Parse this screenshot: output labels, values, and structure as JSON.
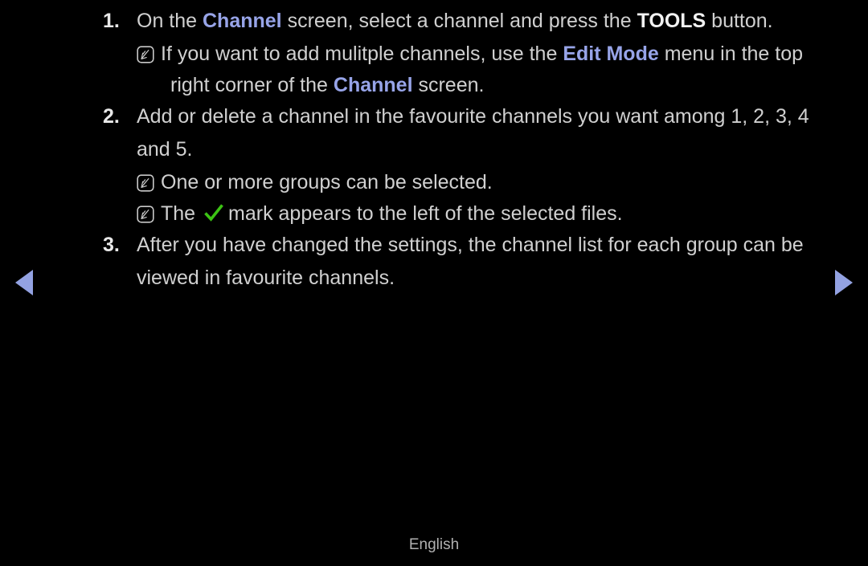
{
  "page": {
    "background_color": "#000000",
    "text_color": "#d0d0d0",
    "highlight_color": "#97a4e8",
    "check_color": "#3cc314",
    "arrow_color": "#93a2e2"
  },
  "steps": [
    {
      "number": "1.",
      "parts": [
        {
          "type": "text",
          "value": "On the "
        },
        {
          "type": "highlight",
          "value": "Channel"
        },
        {
          "type": "text",
          "value": " screen, select a channel and press the "
        },
        {
          "type": "strong",
          "value": "TOOLS"
        },
        {
          "type": "text",
          "value": " button."
        }
      ],
      "text": "On the Channel screen, select a channel and press the TOOLS button."
    },
    {
      "number": "2.",
      "parts": [
        {
          "type": "text",
          "value": "Add or delete a channel in the favourite channels you want among 1, 2, 3, 4 and 5."
        }
      ],
      "text": "Add or delete a channel in the favourite channels you want among 1, 2, 3, 4",
      "continuation": "and 5."
    },
    {
      "number": "3.",
      "parts": [
        {
          "type": "text",
          "value": "After you have changed the settings, the channel list for each group can be viewed in favourite channels."
        }
      ],
      "text": "After you have changed the settings, the channel list for each group can be",
      "continuation": "viewed in favourite channels."
    }
  ],
  "notes": [
    {
      "icon": "note-icon",
      "line1_before": "If you want to add mulitple channels, use the ",
      "highlight1": "Edit Mode",
      "line1_after": " menu in the top",
      "line2_before": "right corner of the ",
      "highlight2": "Channel",
      "line2_after": " screen.",
      "full_text": "If you want to add mulitple channels, use the Edit Mode menu in the top right corner of the Channel screen."
    },
    {
      "icon": "note-icon",
      "text": "One or more groups can be selected."
    },
    {
      "icon": "note-icon",
      "before_check": "The ",
      "after_check": "mark appears to the left of the selected files.",
      "full_text": "The ✓ mark appears to the left of the selected files."
    }
  ],
  "navigation": {
    "previous_label": "Previous page",
    "next_label": "Next page"
  },
  "footer": {
    "language": "English"
  }
}
